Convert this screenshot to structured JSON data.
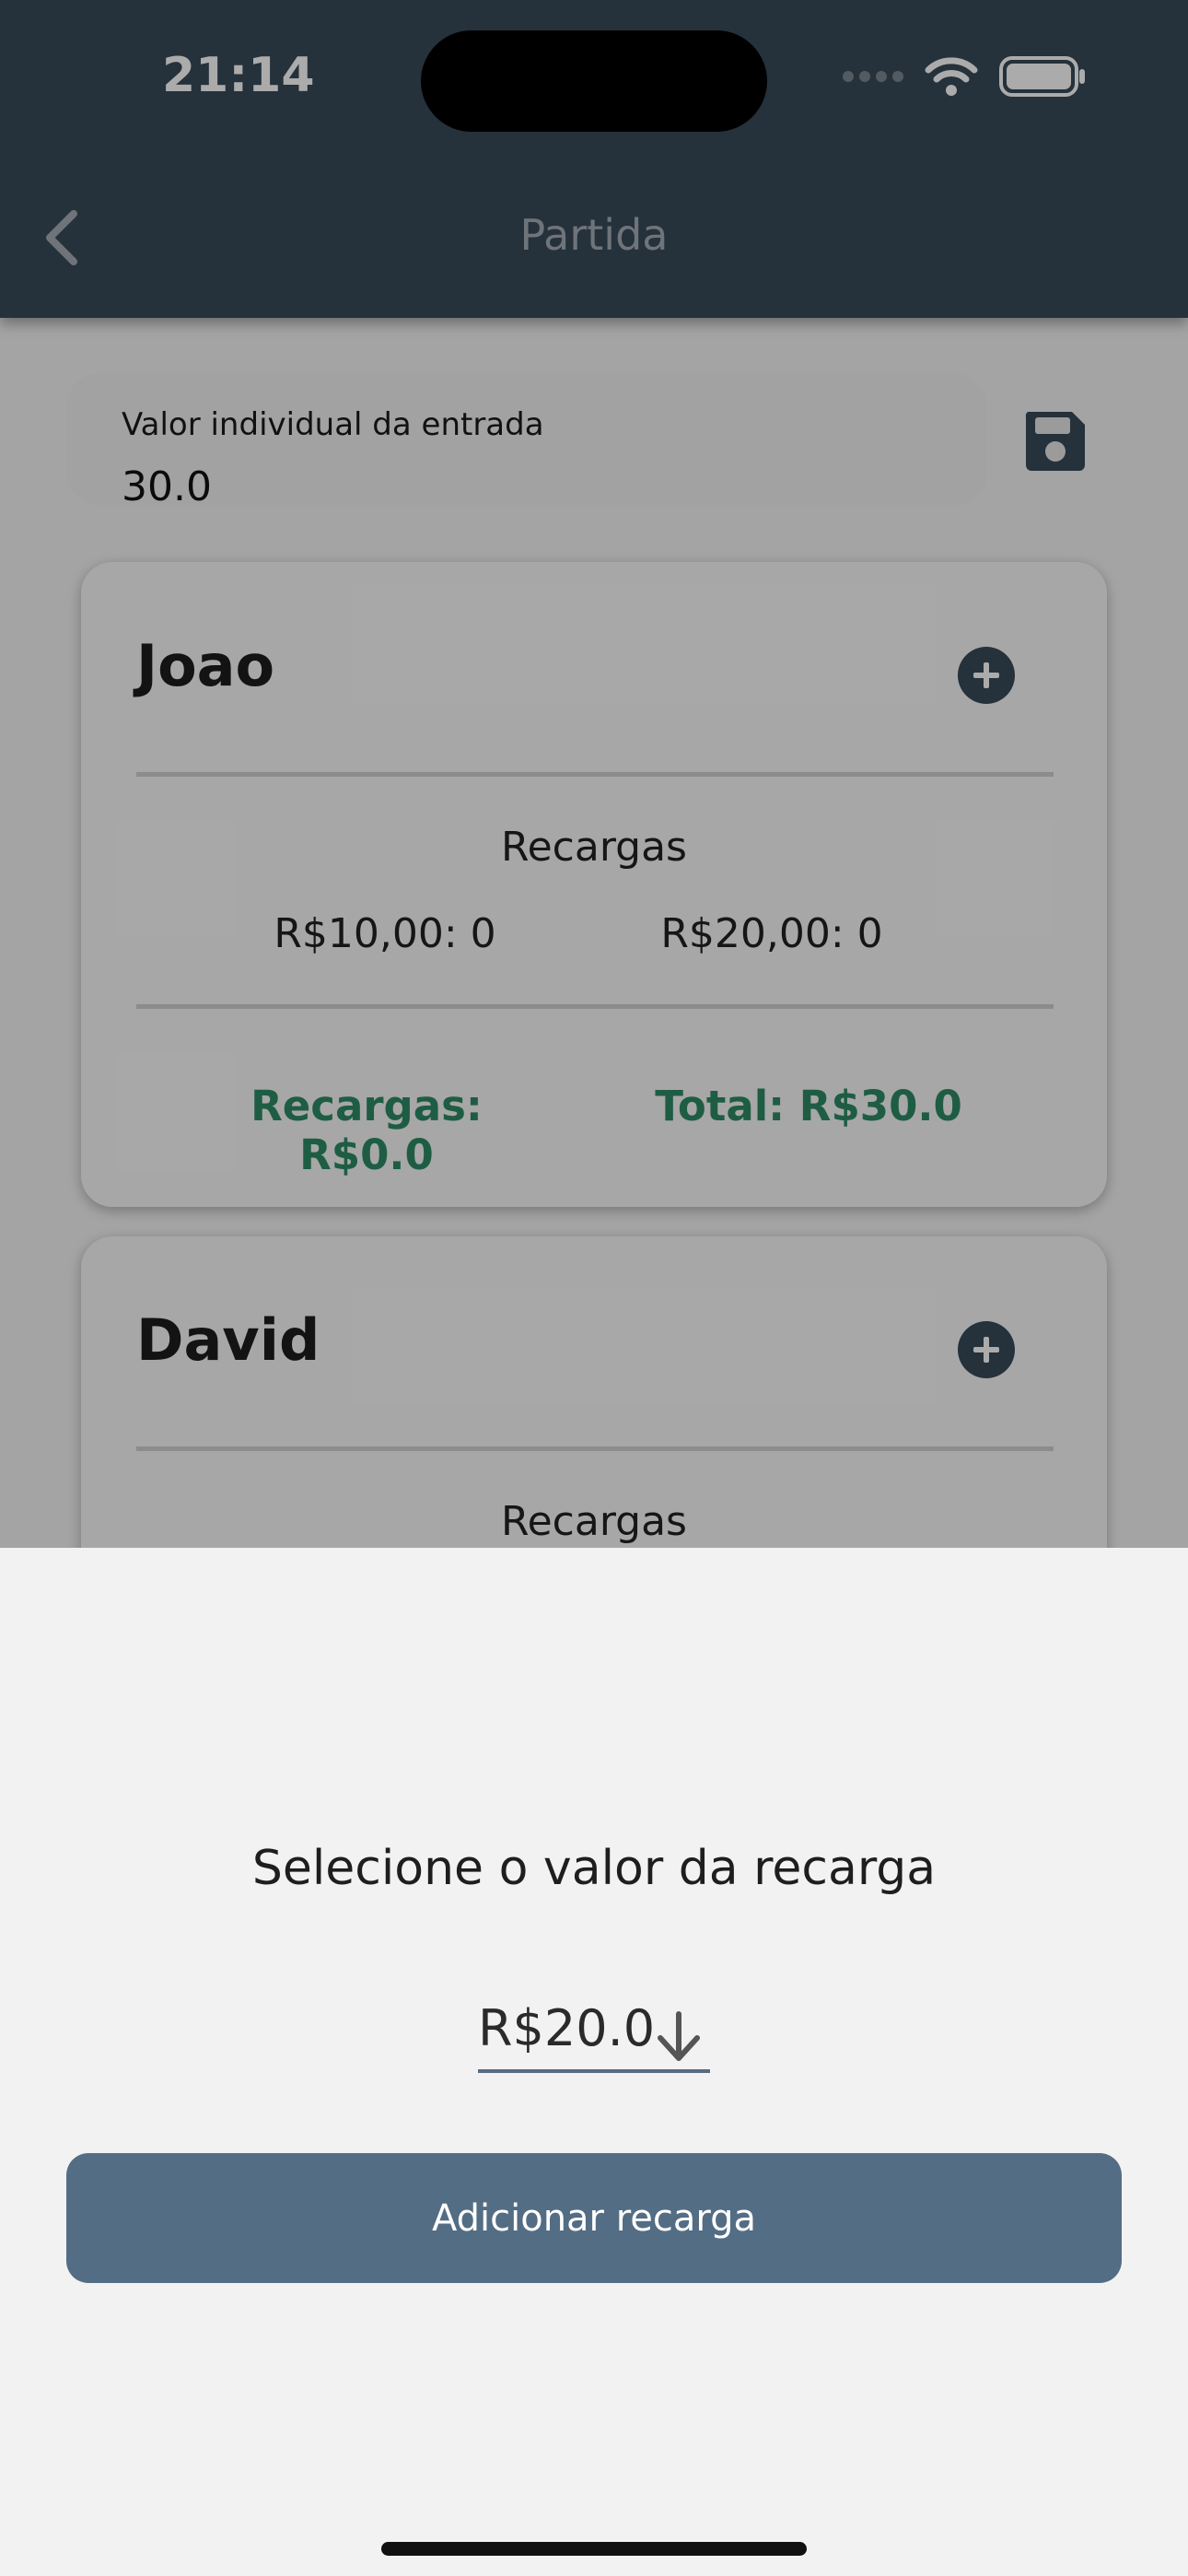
{
  "status_bar": {
    "time": "21:14"
  },
  "nav": {
    "title": "Partida"
  },
  "entry": {
    "label": "Valor individual da entrada",
    "value": "30.0"
  },
  "players": [
    {
      "name": "Joao",
      "recargas_title": "Recargas",
      "count_10": "R$10,00: 0",
      "count_20": "R$20,00: 0",
      "recargas_total": "Recargas: R$0.0",
      "total": "Total: R$30.0"
    },
    {
      "name": "David",
      "recargas_title": "Recargas"
    }
  ],
  "sheet": {
    "title": "Selecione o valor da recarga",
    "selected_value": "R$20.0",
    "button_label": "Adicionar recarga"
  },
  "colors": {
    "topbar": "#384958",
    "accent": "#536d84",
    "positive": "#2e8b66"
  }
}
